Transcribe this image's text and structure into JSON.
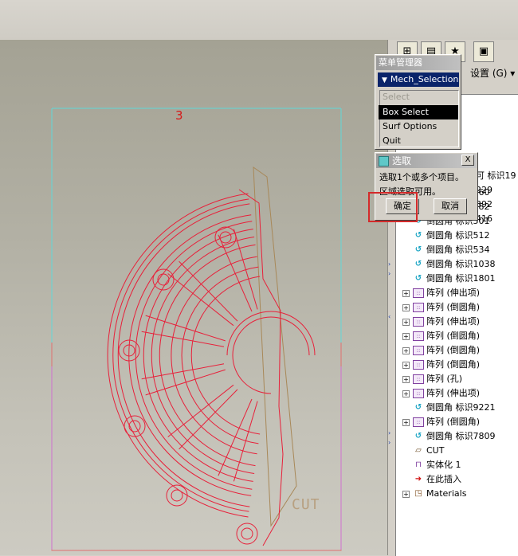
{
  "toolbar": {
    "settings_label": "设置 (G) ▾",
    "icons": [
      "model-tree-icon",
      "folder-icon",
      "star-folder-icon",
      "favorites-icon"
    ]
  },
  "viewport": {
    "view_number": "3",
    "cut_label": "CUT"
  },
  "menu_manager": {
    "title": "菜单管理器",
    "selected": "Mech_Selection (",
    "items": [
      {
        "label": "Select",
        "state": "disabled"
      },
      {
        "label": "Box Select",
        "state": "highlighted"
      },
      {
        "label": "Surf Options",
        "state": "normal"
      },
      {
        "label": "Quit",
        "state": "normal"
      }
    ]
  },
  "select_dialog": {
    "title": "选取",
    "close": "X",
    "line1": "选取1个或多个项目。",
    "line2": "区域选取可用。",
    "ok": "确定",
    "cancel": "取消"
  },
  "tree_partial": {
    "r1": "可 标识19",
    "r2": "229",
    "r3": "392",
    "r4": "416"
  },
  "tree": [
    {
      "label": "倒圆角 标识460",
      "icon": "round-icon",
      "expand": false
    },
    {
      "label": "倒圆角 标识482",
      "icon": "round-icon",
      "expand": false
    },
    {
      "label": "倒圆角 标识501",
      "icon": "round-icon",
      "expand": false
    },
    {
      "label": "倒圆角 标识512",
      "icon": "round-icon",
      "expand": false
    },
    {
      "label": "倒圆角 标识534",
      "icon": "round-icon",
      "expand": false
    },
    {
      "label": "倒圆角 标识1038",
      "icon": "round-icon",
      "expand": false
    },
    {
      "label": "倒圆角 标识1801",
      "icon": "round-icon",
      "expand": false
    },
    {
      "label": "阵列 (伸出项)",
      "icon": "pattern-icon",
      "expand": true
    },
    {
      "label": "阵列 (倒圆角)",
      "icon": "pattern-icon",
      "expand": true
    },
    {
      "label": "阵列 (伸出项)",
      "icon": "pattern-icon",
      "expand": true
    },
    {
      "label": "阵列 (倒圆角)",
      "icon": "pattern-icon",
      "expand": true
    },
    {
      "label": "阵列 (倒圆角)",
      "icon": "pattern-icon",
      "expand": true
    },
    {
      "label": "阵列 (倒圆角)",
      "icon": "pattern-icon",
      "expand": true
    },
    {
      "label": "阵列 (孔)",
      "icon": "pattern-icon",
      "expand": true
    },
    {
      "label": "阵列 (伸出项)",
      "icon": "pattern-icon",
      "expand": true
    },
    {
      "label": "倒圆角 标识9221",
      "icon": "round-icon",
      "expand": false
    },
    {
      "label": "阵列 (倒圆角)",
      "icon": "pattern-icon",
      "expand": true
    },
    {
      "label": "倒圆角 标识7809",
      "icon": "round-icon",
      "expand": false
    },
    {
      "label": "CUT",
      "icon": "cut-plane-icon",
      "expand": false
    },
    {
      "label": "实体化 1",
      "icon": "solidify-icon",
      "expand": false
    },
    {
      "label": "在此插入",
      "icon": "insert-here-icon",
      "expand": false
    },
    {
      "label": "Materials",
      "icon": "materials-icon",
      "expand": true
    }
  ],
  "colors": {
    "model_lines": "#e8203a",
    "cut_plane": "#a88858",
    "highlight_frame": "#d42a2a",
    "menu_selected": "#0a246a"
  }
}
